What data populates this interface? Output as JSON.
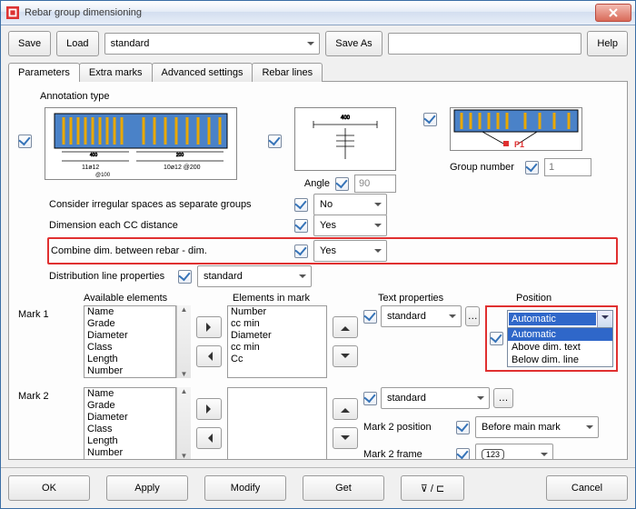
{
  "window": {
    "title": "Rebar group dimensioning"
  },
  "toolbar": {
    "save": "Save",
    "load": "Load",
    "preset": "standard",
    "saveas": "Save As",
    "help": "Help"
  },
  "tabs": [
    "Parameters",
    "Extra marks",
    "Advanced settings",
    "Rebar lines"
  ],
  "annotation_type_label": "Annotation type",
  "angle": {
    "label": "Angle",
    "value": "90"
  },
  "group_number": {
    "label": "Group number",
    "value": "1"
  },
  "preview_dim_text": {
    "a": "11ø12",
    "b": "10ø12 @200"
  },
  "preview3_label": "P1",
  "opts": {
    "irregular": {
      "label": "Consider irregular spaces as separate groups",
      "value": "No"
    },
    "eachcc": {
      "label": "Dimension each CC distance",
      "value": "Yes"
    },
    "combine": {
      "label": "Combine dim. between rebar - dim.",
      "value": "Yes"
    },
    "distline": {
      "label": "Distribution line properties",
      "value": "standard"
    }
  },
  "cols": {
    "available": "Available elements",
    "inmark": "Elements in mark",
    "textprops": "Text properties",
    "position": "Position"
  },
  "mark1": {
    "label": "Mark 1",
    "available": [
      "Name",
      "Grade",
      "Diameter",
      "Class",
      "Length",
      "Number"
    ],
    "inmark": [
      "Number",
      "cc min",
      "Diameter",
      "cc min",
      "Cc"
    ],
    "textprops": "standard",
    "position_selected": "Automatic",
    "position_options": [
      "Automatic",
      "Above dim. text",
      "Below dim. line"
    ]
  },
  "mark2": {
    "label": "Mark 2",
    "available": [
      "Name",
      "Grade",
      "Diameter",
      "Class",
      "Length",
      "Number"
    ],
    "textprops": "standard",
    "pos_label": "Mark 2 position",
    "pos_value": "Before main mark",
    "frame_label": "Mark 2 frame",
    "frame_value": "123"
  },
  "footer": {
    "ok": "OK",
    "apply": "Apply",
    "modify": "Modify",
    "get": "Get",
    "cancel": "Cancel"
  }
}
